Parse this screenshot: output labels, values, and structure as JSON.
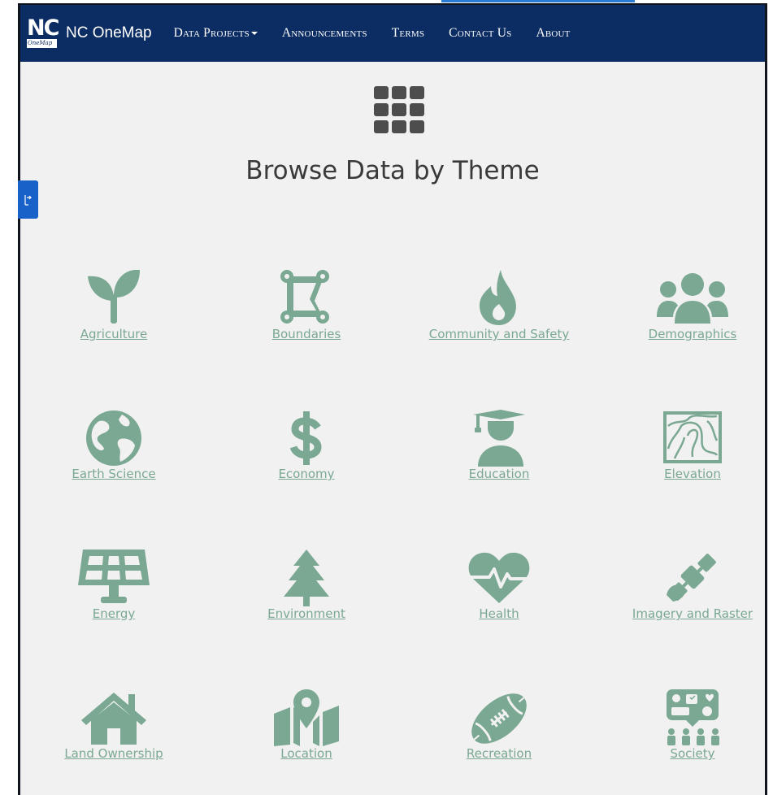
{
  "app": {
    "brand": "NC OneMap",
    "logo_text": "NC",
    "logo_subtext": "OneMap"
  },
  "nav": [
    {
      "label": "Data Projects",
      "dropdown": true
    },
    {
      "label": "Announcements"
    },
    {
      "label": "Terms"
    },
    {
      "label": "Contact Us"
    },
    {
      "label": "About"
    }
  ],
  "page": {
    "title": "Browse Data by Theme",
    "title_icon": "grid-icon"
  },
  "colors": {
    "nav_bg": "#0c2d63",
    "theme_green": "#7aa892",
    "page_bg": "#f1f1f1",
    "side_tab": "#1761c9"
  },
  "themes": [
    {
      "label": "Agriculture",
      "icon": "seedling-icon"
    },
    {
      "label": "Boundaries",
      "icon": "vector-square-icon"
    },
    {
      "label": "Community and Safety",
      "icon": "fire-icon"
    },
    {
      "label": "Demographics",
      "icon": "users-icon"
    },
    {
      "label": "Earth Science",
      "icon": "globe-icon"
    },
    {
      "label": "Economy",
      "icon": "dollar-icon"
    },
    {
      "label": "Education",
      "icon": "graduate-icon"
    },
    {
      "label": "Elevation",
      "icon": "topo-map-icon"
    },
    {
      "label": "Energy",
      "icon": "solar-panel-icon"
    },
    {
      "label": "Environment",
      "icon": "tree-icon"
    },
    {
      "label": "Health",
      "icon": "heart-pulse-icon"
    },
    {
      "label": "Imagery and Raster",
      "icon": "satellite-icon"
    },
    {
      "label": "Land Ownership",
      "icon": "house-icon"
    },
    {
      "label": "Location",
      "icon": "map-location-icon"
    },
    {
      "label": "Recreation",
      "icon": "football-icon"
    },
    {
      "label": "Society",
      "icon": "society-icon"
    }
  ]
}
